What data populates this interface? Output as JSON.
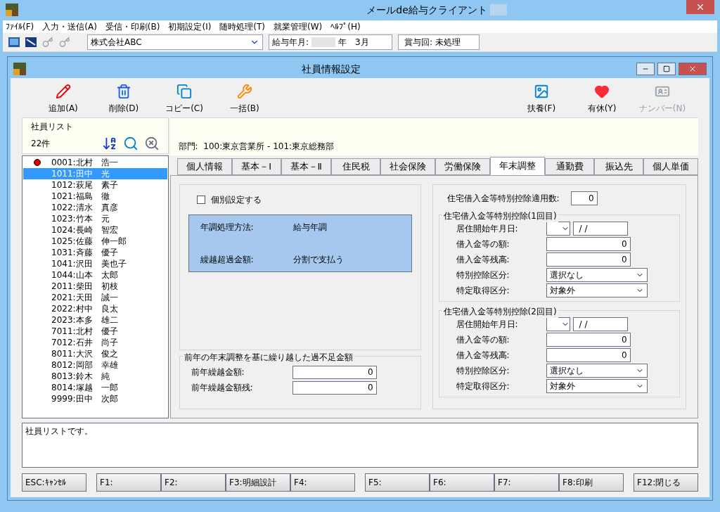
{
  "app": {
    "title": "メールde給与クライアント"
  },
  "menu": [
    "ﾌｧｲﾙ(F)",
    "入力・送信(A)",
    "受信・印刷(B)",
    "初期設定(I)",
    "随時処理(T)",
    "就業管理(W)",
    "ﾍﾙﾌﾟ(H)"
  ],
  "toolbar": {
    "company": "株式会社ABC",
    "pay_month_label": "給与年月:",
    "pay_month_value": "年　3月",
    "bonus": "賞与回: 未処理"
  },
  "window": {
    "title": "社員情報設定"
  },
  "actions_left": [
    {
      "kind": "pencil",
      "label": "追加(A)",
      "disabled": false
    },
    {
      "kind": "trash",
      "label": "削除(D)",
      "disabled": false
    },
    {
      "kind": "copy",
      "label": "コピー(C)",
      "disabled": false
    },
    {
      "kind": "wrench",
      "label": "一括(B)",
      "disabled": false
    }
  ],
  "actions_right": [
    {
      "kind": "photo",
      "label": "扶養(F)",
      "disabled": false
    },
    {
      "kind": "heart",
      "label": "有休(Y)",
      "disabled": false
    },
    {
      "kind": "card",
      "label": "ナンバー(N)",
      "disabled": true
    }
  ],
  "employee_list": {
    "title": "社員リスト",
    "count": "22件",
    "items": [
      {
        "text": "0001:北村　浩一",
        "selected": false,
        "flagged": true
      },
      {
        "text": "1011:田中　光",
        "selected": true,
        "flagged": false
      },
      {
        "text": "1012:萩尾　素子",
        "selected": false,
        "flagged": false
      },
      {
        "text": "1021:福島　徹",
        "selected": false,
        "flagged": false
      },
      {
        "text": "1022:清水　真彦",
        "selected": false,
        "flagged": false
      },
      {
        "text": "1023:竹本　元",
        "selected": false,
        "flagged": false
      },
      {
        "text": "1024:長崎　智宏",
        "selected": false,
        "flagged": false
      },
      {
        "text": "1025:佐藤　伸一郎",
        "selected": false,
        "flagged": false
      },
      {
        "text": "1031:斉藤　優子",
        "selected": false,
        "flagged": false
      },
      {
        "text": "1041:沢田　美也子",
        "selected": false,
        "flagged": false
      },
      {
        "text": "1044:山本　太郎",
        "selected": false,
        "flagged": false
      },
      {
        "text": "2011:柴田　初枝",
        "selected": false,
        "flagged": false
      },
      {
        "text": "2021:天田　誠一",
        "selected": false,
        "flagged": false
      },
      {
        "text": "2022:村中　良太",
        "selected": false,
        "flagged": false
      },
      {
        "text": "2023:本多　雄二",
        "selected": false,
        "flagged": false
      },
      {
        "text": "7011:北村　優子",
        "selected": false,
        "flagged": false
      },
      {
        "text": "7012:石井　尚子",
        "selected": false,
        "flagged": false
      },
      {
        "text": "8011:大沢　俊之",
        "selected": false,
        "flagged": false
      },
      {
        "text": "8012:岡部　幸雄",
        "selected": false,
        "flagged": false
      },
      {
        "text": "8013:鈴木　純",
        "selected": false,
        "flagged": false
      },
      {
        "text": "8014:塚越　一郎",
        "selected": false,
        "flagged": false
      },
      {
        "text": "9999:田中　次郎",
        "selected": false,
        "flagged": false
      }
    ]
  },
  "department": "部門:  100:東京営業所 - 101:東京総務部",
  "tabs": [
    {
      "label": "個人情報",
      "selected": false
    },
    {
      "label": "基本－Ⅰ",
      "selected": false
    },
    {
      "label": "基本－Ⅱ",
      "selected": false
    },
    {
      "label": "住民税",
      "selected": false
    },
    {
      "label": "社会保険",
      "selected": false
    },
    {
      "label": "労働保険",
      "selected": false
    },
    {
      "label": "年末調整",
      "selected": true
    },
    {
      "label": "通勤費",
      "selected": false
    },
    {
      "label": "振込先",
      "selected": false
    },
    {
      "label": "個人単価",
      "selected": false
    }
  ],
  "year_end": {
    "individual": {
      "label": "個別設定する",
      "checked": false
    },
    "info": [
      {
        "label": "年調処理方法:",
        "value": "給与年調"
      },
      {
        "label": "繰越超過金額:",
        "value": "分割で支払う"
      }
    ],
    "carryover": {
      "title": "前年の年末調整を基に繰り越した過不足金額",
      "fields": [
        {
          "label": "前年繰越金額:",
          "value": "0"
        },
        {
          "label": "前年繰越金額残:",
          "value": "0"
        }
      ]
    }
  },
  "housing": {
    "count_label": "住宅借入金等特別控除適用数:",
    "count_value": "0",
    "groups": [
      {
        "title": "住宅借入金等特別控除(1回目)",
        "fields": [
          {
            "kind": "date",
            "label": "居住開始年月日:",
            "value": "/ /"
          },
          {
            "kind": "number",
            "label": "借入金等の額:",
            "value": "0"
          },
          {
            "kind": "number",
            "label": "借入金等残高:",
            "value": "0"
          },
          {
            "kind": "select",
            "label": "特別控除区分:",
            "value": "選択なし"
          },
          {
            "kind": "select",
            "label": "特定取得区分:",
            "value": "対象外"
          }
        ]
      },
      {
        "title": "住宅借入金等特別控除(2回目)",
        "fields": [
          {
            "kind": "date",
            "label": "居住開始年月日:",
            "value": "/ /"
          },
          {
            "kind": "number",
            "label": "借入金等の額:",
            "value": "0"
          },
          {
            "kind": "number",
            "label": "借入金等残高:",
            "value": "0"
          },
          {
            "kind": "select",
            "label": "特別控除区分:",
            "value": "選択なし"
          },
          {
            "kind": "select",
            "label": "特定取得区分:",
            "value": "対象外"
          }
        ]
      }
    ]
  },
  "message": "社員リストです。",
  "function_key_groups": [
    [
      "ESC:ｷｬﾝｾﾙ"
    ],
    [
      "F1:",
      "F2:",
      "F3:明細設計",
      "F4:"
    ],
    [
      "F5:",
      "F6:",
      "F7:",
      "F8:印刷"
    ],
    [
      "F12:閉じる"
    ]
  ]
}
